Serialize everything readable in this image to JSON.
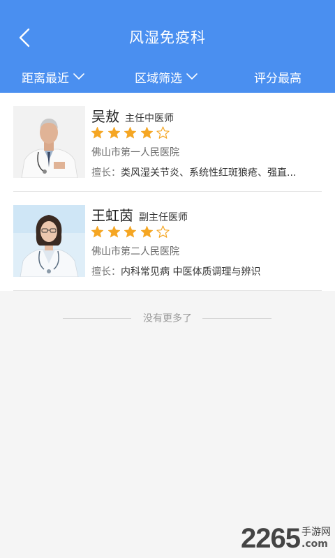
{
  "header": {
    "title": "风湿免疫科",
    "back_icon": "chevron-left-icon",
    "background": "#4a8ff0"
  },
  "filters": [
    {
      "label": "距离最近",
      "icon": "chevron-down-icon"
    },
    {
      "label": "区域筛选",
      "icon": "chevron-down-icon"
    },
    {
      "label": "评分最高"
    }
  ],
  "doctors": [
    {
      "name": "吴敖",
      "rank": "主任中医师",
      "rating": 4,
      "max_rating": 5,
      "hospital": "佛山市第一人民医院",
      "specialty_label": "擅长：",
      "specialty": "类风湿关节炎、系统性红斑狼疮、强直..."
    },
    {
      "name": "王虹茵",
      "rank": "副主任医师",
      "rating": 4,
      "max_rating": 5,
      "hospital": "佛山市第二人民医院",
      "specialty_label": "擅长：",
      "specialty": "内科常见病 中医体质调理与辨识"
    }
  ],
  "footer": {
    "no_more": "没有更多了"
  },
  "watermark": {
    "number": "2265",
    "cn": "手游网",
    "com": ".com"
  },
  "colors": {
    "star": "#f5a623",
    "accent": "#4a8ff0"
  }
}
